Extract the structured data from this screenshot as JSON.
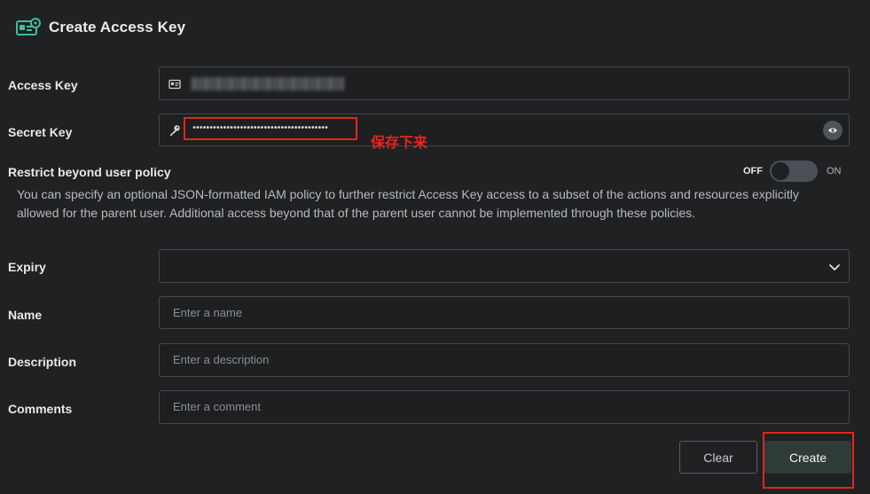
{
  "header": {
    "title": "Create Access Key",
    "icon": "access-key-card-icon"
  },
  "access_key": {
    "label": "Access Key",
    "icon": "id-card-icon"
  },
  "secret_key": {
    "label": "Secret Key",
    "icon": "key-icon",
    "masked_value": "••••••••••••••••••••••••••••••••••••••••",
    "reveal_icon": "eye-icon"
  },
  "annotation": {
    "text": "保存下来",
    "color": "#e8251d"
  },
  "restrict": {
    "label": "Restrict beyond user policy",
    "toggle_off_label": "OFF",
    "toggle_on_label": "ON",
    "state": "off",
    "description": "You can specify an optional JSON-formatted IAM policy to further restrict Access Key access to a subset of the actions and resources explicitly allowed for the parent user. Additional access beyond that of the parent user cannot be implemented through these policies."
  },
  "expiry": {
    "label": "Expiry",
    "value": "",
    "icon": "chevron-down-icon"
  },
  "name": {
    "label": "Name",
    "placeholder": "Enter a name"
  },
  "description_field": {
    "label": "Description",
    "placeholder": "Enter a description"
  },
  "comments": {
    "label": "Comments",
    "placeholder": "Enter a comment"
  },
  "buttons": {
    "clear": "Clear",
    "create": "Create"
  },
  "colors": {
    "accent": "#3fbf9f",
    "annotation_red": "#e0271f",
    "create_bg": "#2f3b37"
  }
}
